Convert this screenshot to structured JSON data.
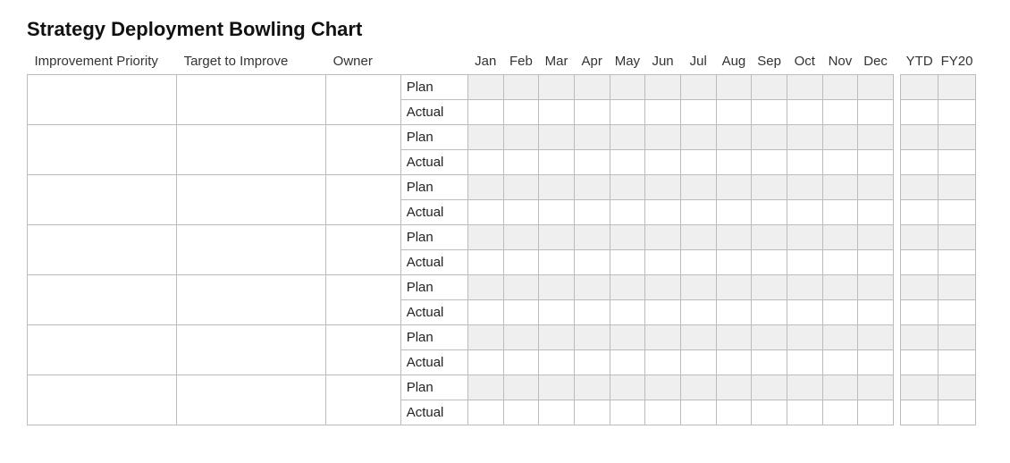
{
  "title": "Strategy Deployment Bowling Chart",
  "headers": {
    "priority": "Improvement Priority",
    "target": "Target to Improve",
    "owner": "Owner",
    "type": "",
    "months": [
      "Jan",
      "Feb",
      "Mar",
      "Apr",
      "May",
      "Jun",
      "Jul",
      "Aug",
      "Sep",
      "Oct",
      "Nov",
      "Dec"
    ],
    "ytd": "YTD",
    "fy": "FY20"
  },
  "row_labels": {
    "plan": "Plan",
    "actual": "Actual"
  },
  "rows": [
    {
      "priority": "",
      "target": "",
      "owner": "",
      "plan": {
        "months": [
          "",
          "",
          "",
          "",
          "",
          "",
          "",
          "",
          "",
          "",
          "",
          ""
        ],
        "ytd": "",
        "fy": ""
      },
      "actual": {
        "months": [
          "",
          "",
          "",
          "",
          "",
          "",
          "",
          "",
          "",
          "",
          "",
          ""
        ],
        "ytd": "",
        "fy": ""
      }
    },
    {
      "priority": "",
      "target": "",
      "owner": "",
      "plan": {
        "months": [
          "",
          "",
          "",
          "",
          "",
          "",
          "",
          "",
          "",
          "",
          "",
          ""
        ],
        "ytd": "",
        "fy": ""
      },
      "actual": {
        "months": [
          "",
          "",
          "",
          "",
          "",
          "",
          "",
          "",
          "",
          "",
          "",
          ""
        ],
        "ytd": "",
        "fy": ""
      }
    },
    {
      "priority": "",
      "target": "",
      "owner": "",
      "plan": {
        "months": [
          "",
          "",
          "",
          "",
          "",
          "",
          "",
          "",
          "",
          "",
          "",
          ""
        ],
        "ytd": "",
        "fy": ""
      },
      "actual": {
        "months": [
          "",
          "",
          "",
          "",
          "",
          "",
          "",
          "",
          "",
          "",
          "",
          ""
        ],
        "ytd": "",
        "fy": ""
      }
    },
    {
      "priority": "",
      "target": "",
      "owner": "",
      "plan": {
        "months": [
          "",
          "",
          "",
          "",
          "",
          "",
          "",
          "",
          "",
          "",
          "",
          ""
        ],
        "ytd": "",
        "fy": ""
      },
      "actual": {
        "months": [
          "",
          "",
          "",
          "",
          "",
          "",
          "",
          "",
          "",
          "",
          "",
          ""
        ],
        "ytd": "",
        "fy": ""
      }
    },
    {
      "priority": "",
      "target": "",
      "owner": "",
      "plan": {
        "months": [
          "",
          "",
          "",
          "",
          "",
          "",
          "",
          "",
          "",
          "",
          "",
          ""
        ],
        "ytd": "",
        "fy": ""
      },
      "actual": {
        "months": [
          "",
          "",
          "",
          "",
          "",
          "",
          "",
          "",
          "",
          "",
          "",
          ""
        ],
        "ytd": "",
        "fy": ""
      }
    },
    {
      "priority": "",
      "target": "",
      "owner": "",
      "plan": {
        "months": [
          "",
          "",
          "",
          "",
          "",
          "",
          "",
          "",
          "",
          "",
          "",
          ""
        ],
        "ytd": "",
        "fy": ""
      },
      "actual": {
        "months": [
          "",
          "",
          "",
          "",
          "",
          "",
          "",
          "",
          "",
          "",
          "",
          ""
        ],
        "ytd": "",
        "fy": ""
      }
    },
    {
      "priority": "",
      "target": "",
      "owner": "",
      "plan": {
        "months": [
          "",
          "",
          "",
          "",
          "",
          "",
          "",
          "",
          "",
          "",
          "",
          ""
        ],
        "ytd": "",
        "fy": ""
      },
      "actual": {
        "months": [
          "",
          "",
          "",
          "",
          "",
          "",
          "",
          "",
          "",
          "",
          "",
          ""
        ],
        "ytd": "",
        "fy": ""
      }
    }
  ]
}
